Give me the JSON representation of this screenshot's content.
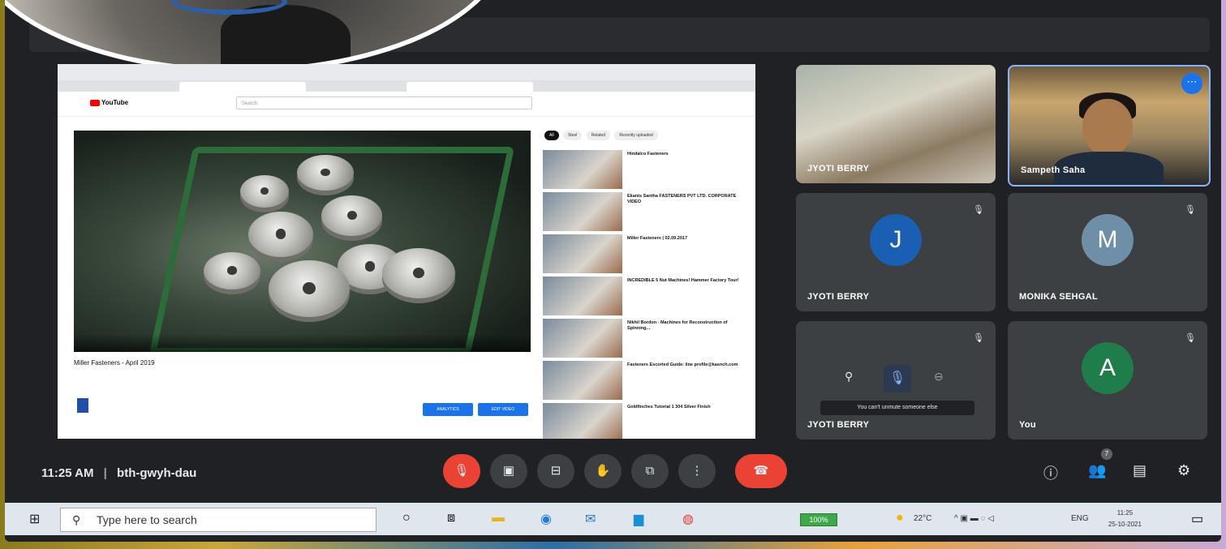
{
  "meeting": {
    "time": "11:25 AM",
    "separator": "|",
    "code": "bth-gwyh-dau"
  },
  "shared_screen": {
    "channel_name": "YouTube",
    "search_placeholder": "Search",
    "video_title": "Miller Fasteners - April 2019",
    "chips": [
      "All",
      "Steel",
      "Related",
      "Recently uploaded"
    ],
    "subscribe_buttons": [
      "ANALYTICS",
      "EDIT VIDEO"
    ],
    "related_titles": [
      "Hindalco Fasteners",
      "Ekants Santha FASTENERS PVT LTD. CORPORATE VIDEO",
      "Miller Fasteners | 02.09.2017",
      "INCREDIBLE 5 Nut Machines! Hammer Factory Tour!",
      "Nikhil Bordon - Machines for Reconstruction of Spinning...",
      "Fasteners Escorted Guide: line profile@kasnch.com",
      "Goldfinches Tutorial 1 304 Silver Finish"
    ]
  },
  "participants": [
    {
      "name": "JYOTI BERRY",
      "type": "video"
    },
    {
      "name": "Sampeth Saha",
      "type": "video"
    },
    {
      "name": "JYOTI BERRY",
      "initial": "J",
      "color": "#1a5fb4"
    },
    {
      "name": "MONIKA SEHGAL",
      "initial": "M",
      "color": "#6f8fa8"
    },
    {
      "name": "JYOTI BERRY",
      "type": "hover",
      "toast": "You can't unmute someone else"
    },
    {
      "name": "You",
      "initial": "A",
      "color": "#1e7d4a"
    }
  ],
  "controls": {
    "people_count": "7",
    "colors": {
      "red": "#ea4335",
      "dark": "#3c4043"
    },
    "buttons": [
      "mic-off-icon",
      "camera-icon",
      "captions-icon",
      "raise-hand-icon",
      "present-icon",
      "more-options-icon",
      "end-call-icon"
    ]
  },
  "taskbar": {
    "search_placeholder": "Type here to search",
    "battery": "100%",
    "temperature": "22°C",
    "lang": "ENG",
    "clock_time": "11:25",
    "clock_date": "25-10-2021"
  }
}
